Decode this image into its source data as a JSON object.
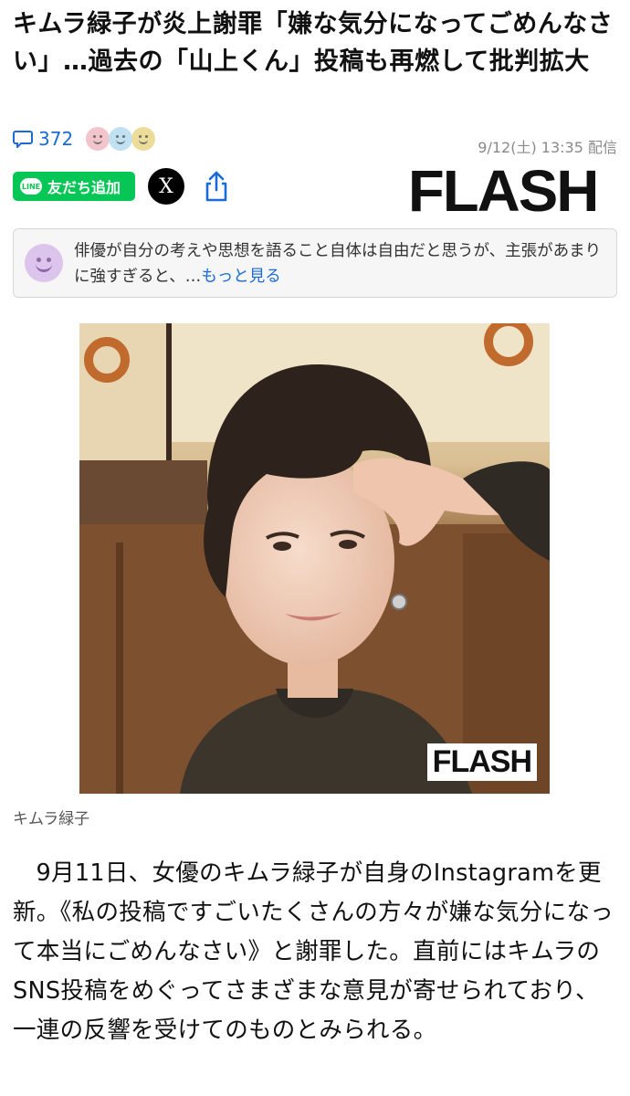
{
  "article": {
    "headline": "キムラ緑子が炎上謝罪「嫌な気分になってごめんなさい」…過去の「山上くん」投稿も再燃して批判拡大",
    "comment_count": "372",
    "date": "9/12(土) 13:35 配信",
    "publisher": "FLASH",
    "photo_caption": "キムラ緑子",
    "photo_watermark": "FLASH",
    "body": "9月11日、女優のキムラ緑子が自身のInstagramを更新。《私の投稿ですごいたくさんの方々が嫌な気分になって本当にごめんなさい》と謝罪した。直前にはキムラのSNS投稿をめぐってさまざまな意見が寄せられており、一連の反響を受けてのものとみられる。"
  },
  "share": {
    "line_label": "友だち追加",
    "line_logo_text": "LINE",
    "x_label": "X"
  },
  "summary": {
    "text": "俳優が自分の考えや思想を語ること自体は自由だと思うが、主張があまりに強すぎると、…",
    "more_label": "もっと見る"
  },
  "icons": {
    "comment": "comment-bubble-icon",
    "reactions": "reaction-faces-icon",
    "share": "share-icon",
    "summary_avatar": "smiley-avatar-icon"
  },
  "colors": {
    "link": "#1a6bd6",
    "line_green": "#06c755",
    "summary_bg": "#f6f6f7"
  }
}
